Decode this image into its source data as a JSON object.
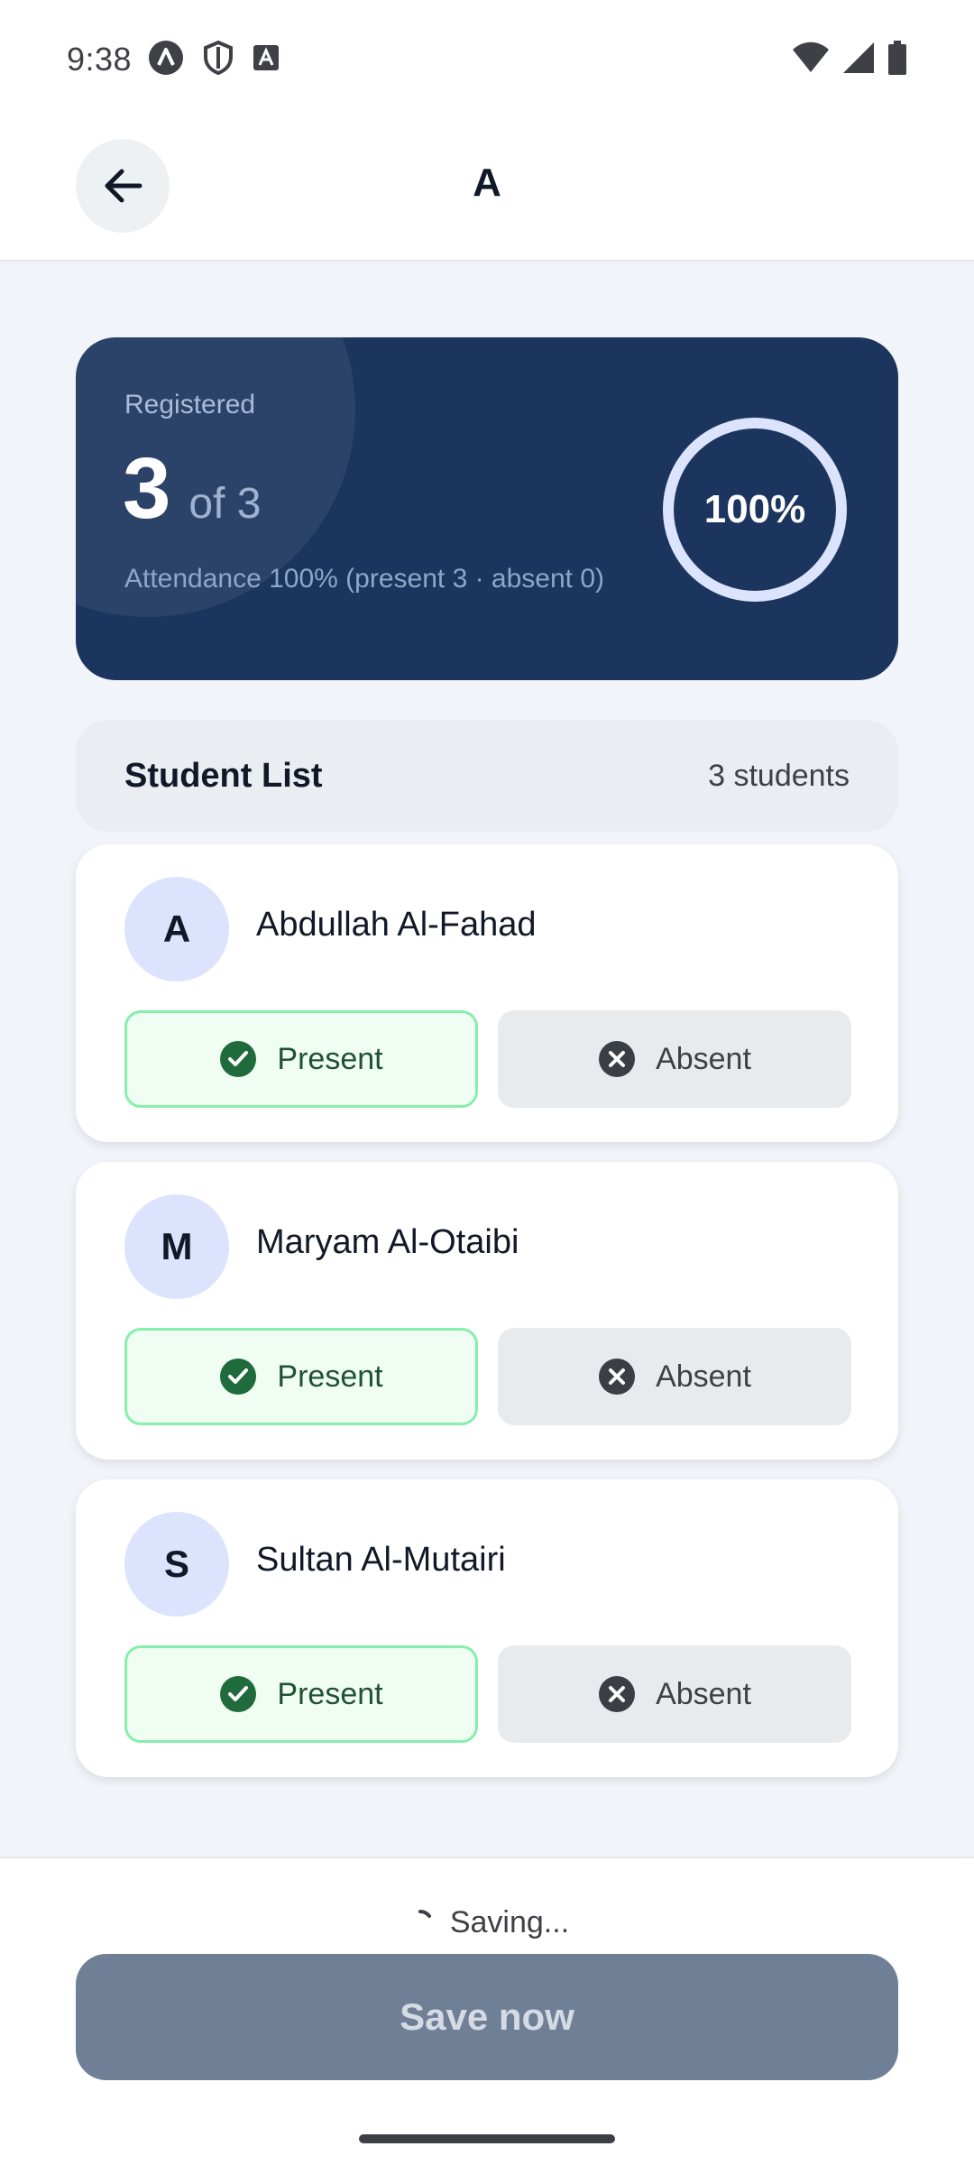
{
  "status_bar": {
    "time": "9:38",
    "icons_left": [
      "a-badge-icon",
      "shield-icon",
      "a-square-icon"
    ],
    "icons_right": [
      "wifi-icon",
      "signal-icon",
      "battery-icon"
    ]
  },
  "app_bar": {
    "title": "A",
    "back_icon": "arrow-left-icon"
  },
  "summary": {
    "label": "Registered",
    "count": "3",
    "of_total": "of 3",
    "detail": "Attendance 100% (present 3 · absent 0)",
    "percent_label": "100%",
    "percent_value": 100,
    "colors": {
      "card": "#1c355e",
      "ring": "#dbe4fc"
    }
  },
  "list": {
    "title": "Student List",
    "count_label": "3 students"
  },
  "students": [
    {
      "initial": "A",
      "name": "Abdullah Al-Fahad",
      "present_label": "Present",
      "absent_label": "Absent",
      "status": "present"
    },
    {
      "initial": "M",
      "name": "Maryam Al-Otaibi",
      "present_label": "Present",
      "absent_label": "Absent",
      "status": "present"
    },
    {
      "initial": "S",
      "name": "Sultan Al-Mutairi",
      "present_label": "Present",
      "absent_label": "Absent",
      "status": "present"
    }
  ],
  "footer": {
    "saving_label": "Saving...",
    "save_button_label": "Save now"
  }
}
